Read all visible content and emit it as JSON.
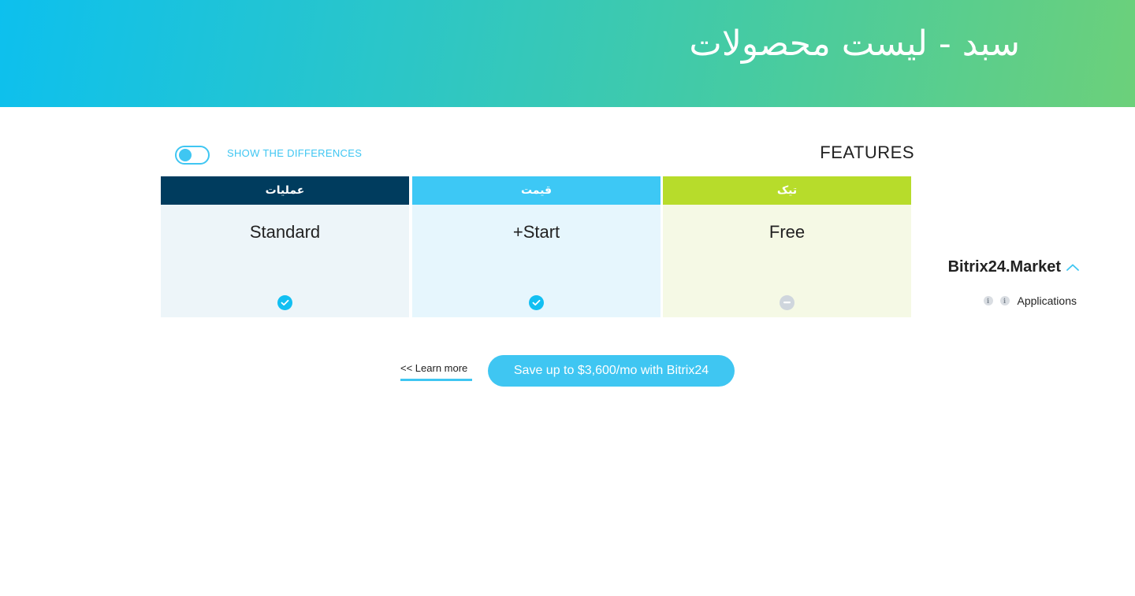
{
  "header": {
    "title": "سبد - لیست محصولات"
  },
  "controls": {
    "show_differences_label": "SHOW THE DIFFERENCES",
    "show_differences_on": true,
    "features_title": "FEATURES"
  },
  "plans": [
    {
      "header": "عملیات",
      "name": "Standard",
      "status": "included",
      "status_icon": "check-circle-icon",
      "header_color": "#003c5e",
      "body_color": "#edf5f9"
    },
    {
      "header": "قیمت",
      "name": "+Start",
      "status": "included",
      "status_icon": "check-circle-icon",
      "header_color": "#3dc8f5",
      "body_color": "#e6f6fd"
    },
    {
      "header": "تیک",
      "name": "Free",
      "status": "not-included",
      "status_icon": "minus-circle-icon",
      "header_color": "#b7dc2b",
      "body_color": "#f5f9e5"
    }
  ],
  "feature_group": {
    "label": "Bitrix24.Market",
    "expanded": true,
    "icon": "chevron-up-icon"
  },
  "feature_row": {
    "label": "Applications",
    "info_icon_glyph": "i"
  },
  "footer": {
    "learn_more": "<< Learn more",
    "save_button": "Save up to $3,600/mo with Bitrix24"
  },
  "colors": {
    "accent": "#3fc6f2",
    "check": "#12bff2",
    "dash": "#cfd6dd"
  }
}
